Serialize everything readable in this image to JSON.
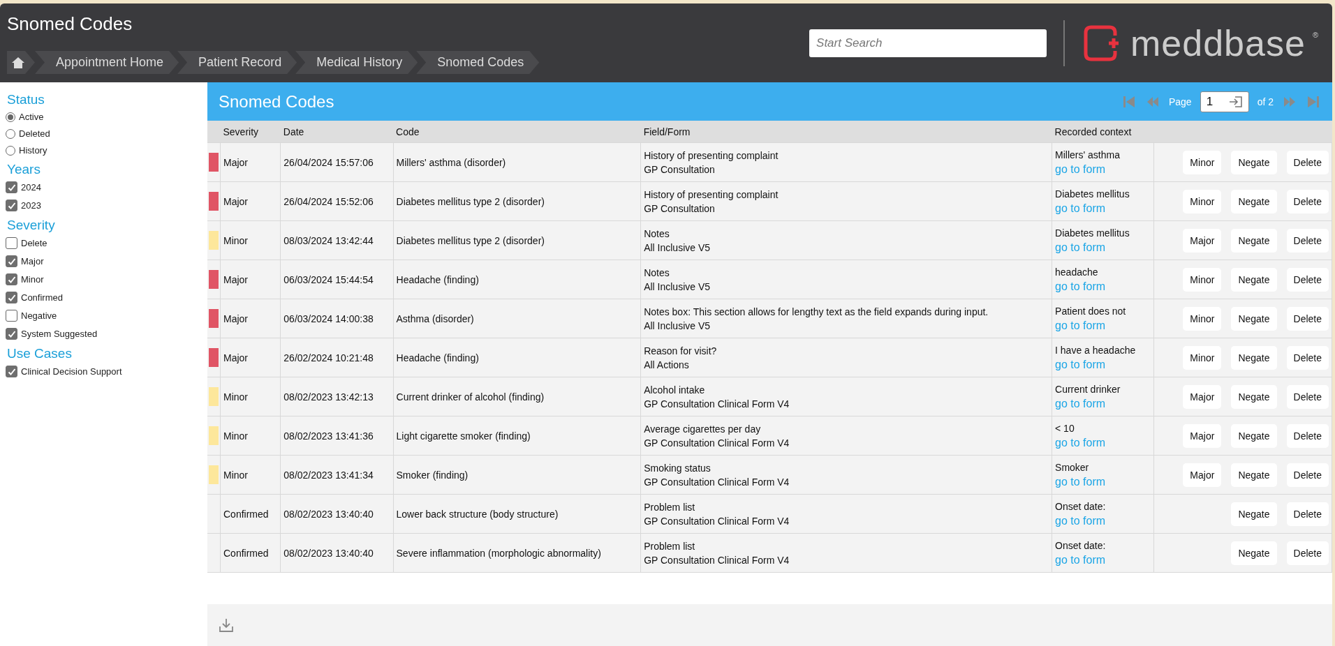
{
  "header": {
    "title": "Snomed Codes",
    "breadcrumbs": [
      "Appointment Home",
      "Patient Record",
      "Medical History",
      "Snomed Codes"
    ],
    "search": {
      "placeholder": "Start Search"
    },
    "logo": {
      "text": "meddbase",
      "mark": "®"
    }
  },
  "sidebar": {
    "sections": [
      {
        "title": "Status",
        "kind": "radio",
        "items": [
          {
            "label": "Active",
            "selected": true
          },
          {
            "label": "Deleted",
            "selected": false
          },
          {
            "label": "History",
            "selected": false
          }
        ]
      },
      {
        "title": "Years",
        "kind": "checkbox",
        "items": [
          {
            "label": "2024",
            "checked": true
          },
          {
            "label": "2023",
            "checked": true
          }
        ]
      },
      {
        "title": "Severity",
        "kind": "checkbox",
        "items": [
          {
            "label": "Delete",
            "checked": false
          },
          {
            "label": "Major",
            "checked": true
          },
          {
            "label": "Minor",
            "checked": true
          },
          {
            "label": "Confirmed",
            "checked": true
          },
          {
            "label": "Negative",
            "checked": false
          },
          {
            "label": "System Suggested",
            "checked": true
          }
        ]
      },
      {
        "title": "Use Cases",
        "kind": "checkbox",
        "items": [
          {
            "label": "Clinical Decision Support",
            "checked": true
          }
        ]
      }
    ]
  },
  "panel": {
    "title": "Snomed Codes",
    "pager": {
      "label": "Page",
      "value": "1",
      "total": "of 2"
    }
  },
  "table": {
    "columns": [
      "Severity",
      "Date",
      "Code",
      "Field/Form",
      "Recorded context"
    ],
    "rows": [
      {
        "color": "#e05565",
        "severity": "Major",
        "date": "26/04/2024 15:57:06",
        "code": "Millers' asthma (disorder)",
        "field": "History of presenting complaint",
        "form": "GP Consultation",
        "context": "Millers' asthma",
        "link": "go to form",
        "actions": [
          "Minor",
          "Negate",
          "Delete"
        ]
      },
      {
        "color": "#e05565",
        "severity": "Major",
        "date": "26/04/2024 15:52:06",
        "code": "Diabetes mellitus type 2 (disorder)",
        "field": "History of presenting complaint",
        "form": "GP Consultation",
        "context": "Diabetes mellitus",
        "link": "go to form",
        "actions": [
          "Minor",
          "Negate",
          "Delete"
        ]
      },
      {
        "color": "#fde79b",
        "severity": "Minor",
        "date": "08/03/2024 13:42:44",
        "code": "Diabetes mellitus type 2 (disorder)",
        "field": "Notes",
        "form": "All Inclusive V5",
        "context": "Diabetes mellitus",
        "link": "go to form",
        "actions": [
          "Major",
          "Negate",
          "Delete"
        ]
      },
      {
        "color": "#e05565",
        "severity": "Major",
        "date": "06/03/2024 15:44:54",
        "code": "Headache (finding)",
        "field": "Notes",
        "form": "All Inclusive V5",
        "context": "headache",
        "link": "go to form",
        "actions": [
          "Minor",
          "Negate",
          "Delete"
        ]
      },
      {
        "color": "#e05565",
        "severity": "Major",
        "date": "06/03/2024 14:00:38",
        "code": "Asthma (disorder)",
        "field": "Notes box: This section allows for lengthy text as the field expands during input.",
        "form": "All Inclusive V5",
        "context": "Patient does not",
        "link": "go to form",
        "actions": [
          "Minor",
          "Negate",
          "Delete"
        ]
      },
      {
        "color": "#e05565",
        "severity": "Major",
        "date": "26/02/2024 10:21:48",
        "code": "Headache (finding)",
        "field": "Reason for visit?",
        "form": "All Actions",
        "context": "I have a headache",
        "link": "go to form",
        "actions": [
          "Minor",
          "Negate",
          "Delete"
        ]
      },
      {
        "color": "#fde79b",
        "severity": "Minor",
        "date": "08/02/2023 13:42:13",
        "code": "Current drinker of alcohol (finding)",
        "field": "Alcohol intake",
        "form": "GP Consultation Clinical Form V4",
        "context": "Current drinker",
        "link": "go to form",
        "actions": [
          "Major",
          "Negate",
          "Delete"
        ]
      },
      {
        "color": "#fde79b",
        "severity": "Minor",
        "date": "08/02/2023 13:41:36",
        "code": "Light cigarette smoker (finding)",
        "field": "Average cigarettes per day",
        "form": "GP Consultation Clinical Form V4",
        "context": "< 10",
        "link": "go to form",
        "actions": [
          "Major",
          "Negate",
          "Delete"
        ]
      },
      {
        "color": "#fde79b",
        "severity": "Minor",
        "date": "08/02/2023 13:41:34",
        "code": "Smoker (finding)",
        "field": "Smoking status",
        "form": "GP Consultation Clinical Form V4",
        "context": "Smoker",
        "link": "go to form",
        "actions": [
          "Major",
          "Negate",
          "Delete"
        ]
      },
      {
        "severity": "Confirmed",
        "date": "08/02/2023 13:40:40",
        "code": "Lower back structure (body structure)",
        "field": "Problem list",
        "form": "GP Consultation Clinical Form V4",
        "context": "Onset date:",
        "link": "go to form",
        "actions": [
          "Negate",
          "Delete"
        ]
      },
      {
        "severity": "Confirmed",
        "date": "08/02/2023 13:40:40",
        "code": "Severe inflammation (morphologic abnormality)",
        "field": "Problem list",
        "form": "GP Consultation Clinical Form V4",
        "context": "Onset date:",
        "link": "go to form",
        "actions": [
          "Negate",
          "Delete"
        ]
      }
    ]
  }
}
